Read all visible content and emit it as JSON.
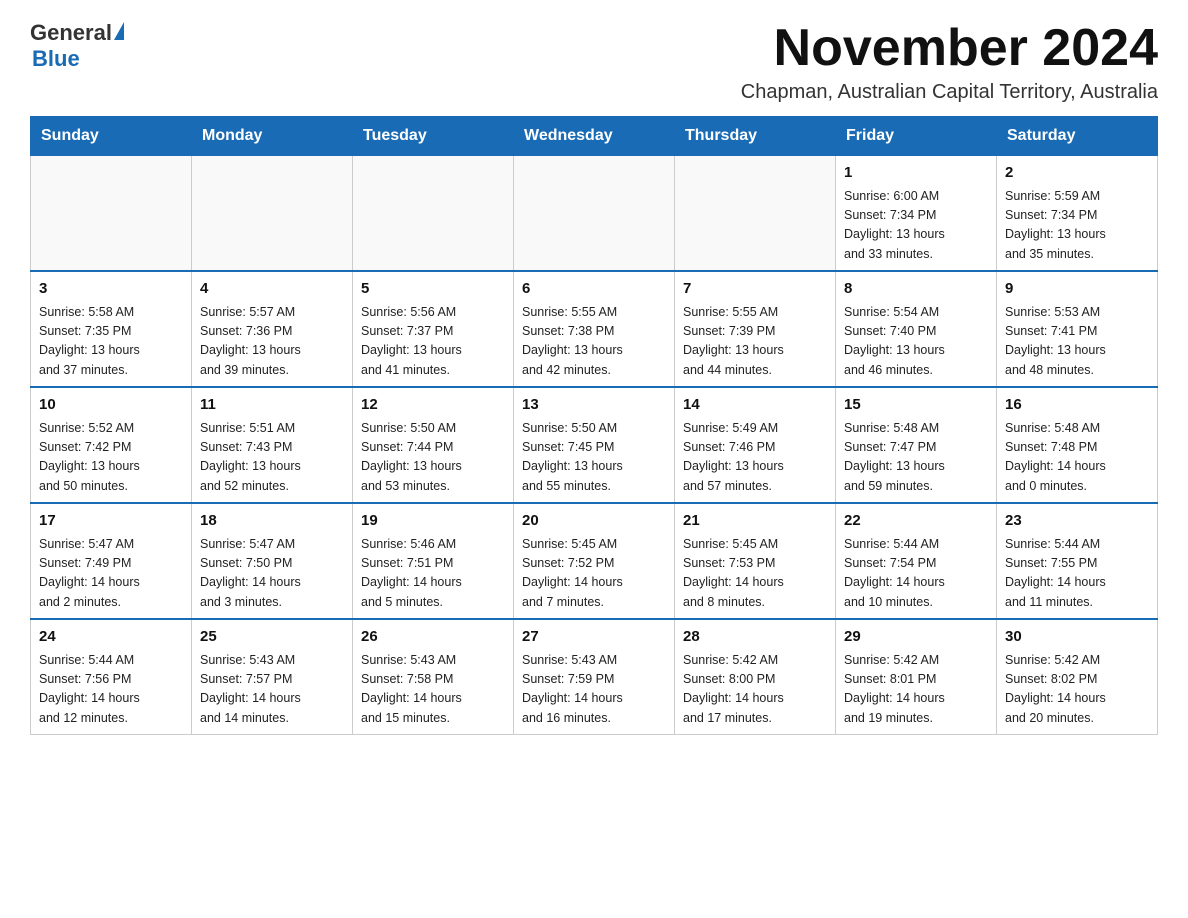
{
  "logo": {
    "general": "General",
    "blue": "Blue"
  },
  "title": "November 2024",
  "subtitle": "Chapman, Australian Capital Territory, Australia",
  "days_of_week": [
    "Sunday",
    "Monday",
    "Tuesday",
    "Wednesday",
    "Thursday",
    "Friday",
    "Saturday"
  ],
  "weeks": [
    [
      {
        "day": "",
        "info": ""
      },
      {
        "day": "",
        "info": ""
      },
      {
        "day": "",
        "info": ""
      },
      {
        "day": "",
        "info": ""
      },
      {
        "day": "",
        "info": ""
      },
      {
        "day": "1",
        "info": "Sunrise: 6:00 AM\nSunset: 7:34 PM\nDaylight: 13 hours\nand 33 minutes."
      },
      {
        "day": "2",
        "info": "Sunrise: 5:59 AM\nSunset: 7:34 PM\nDaylight: 13 hours\nand 35 minutes."
      }
    ],
    [
      {
        "day": "3",
        "info": "Sunrise: 5:58 AM\nSunset: 7:35 PM\nDaylight: 13 hours\nand 37 minutes."
      },
      {
        "day": "4",
        "info": "Sunrise: 5:57 AM\nSunset: 7:36 PM\nDaylight: 13 hours\nand 39 minutes."
      },
      {
        "day": "5",
        "info": "Sunrise: 5:56 AM\nSunset: 7:37 PM\nDaylight: 13 hours\nand 41 minutes."
      },
      {
        "day": "6",
        "info": "Sunrise: 5:55 AM\nSunset: 7:38 PM\nDaylight: 13 hours\nand 42 minutes."
      },
      {
        "day": "7",
        "info": "Sunrise: 5:55 AM\nSunset: 7:39 PM\nDaylight: 13 hours\nand 44 minutes."
      },
      {
        "day": "8",
        "info": "Sunrise: 5:54 AM\nSunset: 7:40 PM\nDaylight: 13 hours\nand 46 minutes."
      },
      {
        "day": "9",
        "info": "Sunrise: 5:53 AM\nSunset: 7:41 PM\nDaylight: 13 hours\nand 48 minutes."
      }
    ],
    [
      {
        "day": "10",
        "info": "Sunrise: 5:52 AM\nSunset: 7:42 PM\nDaylight: 13 hours\nand 50 minutes."
      },
      {
        "day": "11",
        "info": "Sunrise: 5:51 AM\nSunset: 7:43 PM\nDaylight: 13 hours\nand 52 minutes."
      },
      {
        "day": "12",
        "info": "Sunrise: 5:50 AM\nSunset: 7:44 PM\nDaylight: 13 hours\nand 53 minutes."
      },
      {
        "day": "13",
        "info": "Sunrise: 5:50 AM\nSunset: 7:45 PM\nDaylight: 13 hours\nand 55 minutes."
      },
      {
        "day": "14",
        "info": "Sunrise: 5:49 AM\nSunset: 7:46 PM\nDaylight: 13 hours\nand 57 minutes."
      },
      {
        "day": "15",
        "info": "Sunrise: 5:48 AM\nSunset: 7:47 PM\nDaylight: 13 hours\nand 59 minutes."
      },
      {
        "day": "16",
        "info": "Sunrise: 5:48 AM\nSunset: 7:48 PM\nDaylight: 14 hours\nand 0 minutes."
      }
    ],
    [
      {
        "day": "17",
        "info": "Sunrise: 5:47 AM\nSunset: 7:49 PM\nDaylight: 14 hours\nand 2 minutes."
      },
      {
        "day": "18",
        "info": "Sunrise: 5:47 AM\nSunset: 7:50 PM\nDaylight: 14 hours\nand 3 minutes."
      },
      {
        "day": "19",
        "info": "Sunrise: 5:46 AM\nSunset: 7:51 PM\nDaylight: 14 hours\nand 5 minutes."
      },
      {
        "day": "20",
        "info": "Sunrise: 5:45 AM\nSunset: 7:52 PM\nDaylight: 14 hours\nand 7 minutes."
      },
      {
        "day": "21",
        "info": "Sunrise: 5:45 AM\nSunset: 7:53 PM\nDaylight: 14 hours\nand 8 minutes."
      },
      {
        "day": "22",
        "info": "Sunrise: 5:44 AM\nSunset: 7:54 PM\nDaylight: 14 hours\nand 10 minutes."
      },
      {
        "day": "23",
        "info": "Sunrise: 5:44 AM\nSunset: 7:55 PM\nDaylight: 14 hours\nand 11 minutes."
      }
    ],
    [
      {
        "day": "24",
        "info": "Sunrise: 5:44 AM\nSunset: 7:56 PM\nDaylight: 14 hours\nand 12 minutes."
      },
      {
        "day": "25",
        "info": "Sunrise: 5:43 AM\nSunset: 7:57 PM\nDaylight: 14 hours\nand 14 minutes."
      },
      {
        "day": "26",
        "info": "Sunrise: 5:43 AM\nSunset: 7:58 PM\nDaylight: 14 hours\nand 15 minutes."
      },
      {
        "day": "27",
        "info": "Sunrise: 5:43 AM\nSunset: 7:59 PM\nDaylight: 14 hours\nand 16 minutes."
      },
      {
        "day": "28",
        "info": "Sunrise: 5:42 AM\nSunset: 8:00 PM\nDaylight: 14 hours\nand 17 minutes."
      },
      {
        "day": "29",
        "info": "Sunrise: 5:42 AM\nSunset: 8:01 PM\nDaylight: 14 hours\nand 19 minutes."
      },
      {
        "day": "30",
        "info": "Sunrise: 5:42 AM\nSunset: 8:02 PM\nDaylight: 14 hours\nand 20 minutes."
      }
    ]
  ]
}
